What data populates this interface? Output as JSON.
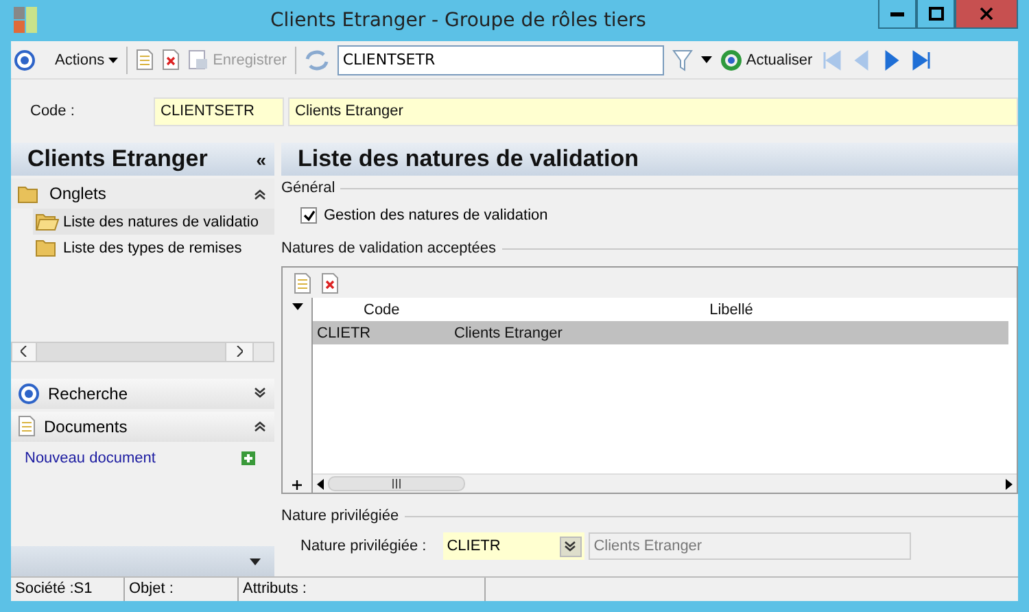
{
  "window": {
    "title": "Clients Etranger -  Groupe de rôles tiers"
  },
  "toolbar": {
    "actions_label": "Actions",
    "save": {
      "label": "Enregistrer",
      "disabled": true
    },
    "search_value": "CLIENTSETR",
    "refresh_label": "Actualiser",
    "nav": [
      {
        "kind": "first",
        "disabled": true
      },
      {
        "kind": "prev",
        "disabled": true
      },
      {
        "kind": "next",
        "disabled": false
      },
      {
        "kind": "last",
        "disabled": false
      }
    ]
  },
  "code_row": {
    "label": "Code :",
    "code": "CLIENTSETR",
    "description": "Clients Etranger"
  },
  "sidebar": {
    "title": "Clients Etranger",
    "collapse_glyph": "«",
    "tabs_section": {
      "title": "Onglets",
      "expanded": true,
      "items": [
        {
          "label": "Liste des natures de validatio",
          "selected": true
        },
        {
          "label": "Liste des types de remises",
          "selected": false
        }
      ]
    },
    "search_section": {
      "title": "Recherche",
      "expanded": false
    },
    "documents_section": {
      "title": "Documents",
      "expanded": true,
      "link": "Nouveau document"
    }
  },
  "main": {
    "title": "Liste des natures de validation",
    "general": {
      "title": "Général",
      "checkbox": {
        "label": "Gestion des natures de validation",
        "checked": true
      }
    },
    "accepted": {
      "title": "Natures de validation acceptées",
      "columns": [
        "Code",
        "Libellé"
      ],
      "rows": [
        {
          "code": "CLIETR",
          "label": "Clients Etranger",
          "selected": true
        }
      ]
    },
    "preferred": {
      "title": "Nature privilégiée",
      "label": "Nature privilégiée :",
      "value": "CLIETR",
      "description": "Clients Etranger"
    }
  },
  "status_bar": [
    "Société :S1",
    "Objet :",
    "Attributs :"
  ]
}
